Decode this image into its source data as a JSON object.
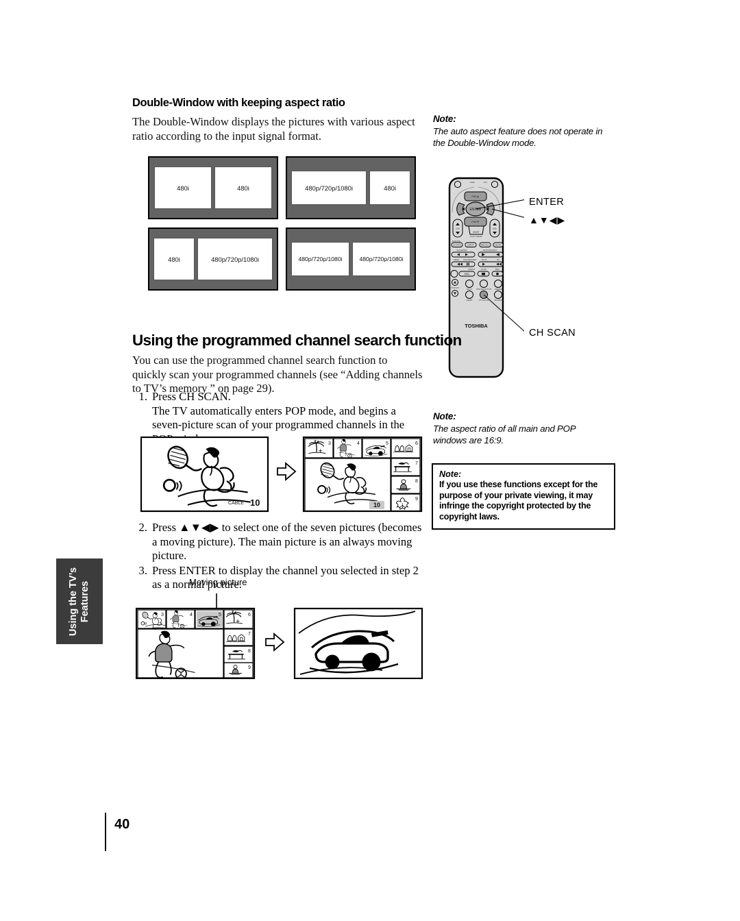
{
  "page": {
    "number": "40",
    "side_tab_label": "Using the TV’s\nFeatures"
  },
  "sections": {
    "double_window": {
      "heading": "Double-Window with keeping aspect ratio",
      "body": "The Double-Window displays the pictures with various aspect ratio according to the input signal format."
    },
    "channel_search": {
      "heading": "Using the programmed channel search function",
      "body": "You can use the programmed channel search function to quickly scan your programmed channels (see “Adding channels to TV’s memory ” on page 29).",
      "steps": [
        {
          "num": "1.",
          "text": "Press CH SCAN.\nThe TV automatically enters POP mode, and begins a seven-picture scan of your programmed channels in the POP window."
        },
        {
          "num": "2.",
          "text": "Press ▲▼◀▶ to select one of the seven pictures (becomes a moving picture). The main picture is an always moving picture."
        },
        {
          "num": "3.",
          "text": "Press ENTER to display the channel you selected in step 2 as a normal picture."
        }
      ]
    }
  },
  "notes": {
    "auto_aspect": {
      "title": "Note:",
      "text": "The auto aspect feature does not operate in the Double-Window mode."
    },
    "aspect_169": {
      "title": "Note:",
      "text": "The aspect ratio of all main and POP windows are 16:9."
    },
    "copyright": {
      "title": "Note:",
      "text": "If you use these functions except for the purpose of your private viewing, it may infringe the copyright protected by the copyright laws."
    }
  },
  "double_window_diagrams": [
    {
      "id": "dw-1",
      "left_pane": "480i",
      "right_pane": "480i",
      "left_shape": "square",
      "right_shape": "square"
    },
    {
      "id": "dw-2",
      "left_pane": "480p/720p/1080i",
      "right_pane": "480i",
      "left_shape": "wide",
      "right_shape": "narrow"
    },
    {
      "id": "dw-3",
      "left_pane": "480i",
      "right_pane": "480p/720p/1080i",
      "left_shape": "square-small",
      "right_shape": "wide-tall"
    },
    {
      "id": "dw-4",
      "left_pane": "480p/720p/1080i",
      "right_pane": "480p/720p/1080i",
      "left_shape": "half",
      "right_shape": "half"
    }
  ],
  "remote": {
    "brand": "TOSHIBA",
    "center_button": "ENTER",
    "fav_up": "FAV▲",
    "fav_down": "FAV▼",
    "exit_button": "EXIT",
    "exit_sub": "DVD CLEAR",
    "ch_rocker": "CH",
    "vol_rocker": "VOL",
    "row_labels_1": [
      "CH RTN",
      "INPUT",
      "RECALL",
      "MUTE"
    ],
    "row_labels_1_top": [
      "DVD RTN",
      "",
      "",
      ""
    ],
    "transport_group_1": "SLOW/DIR",
    "transport_group_2": "SKIP/SEARCH",
    "transport_labels_2": [
      "REW",
      "PAUSE/STEP",
      "PLAY",
      "FF"
    ],
    "transport_labels_3": [
      "AM/FM",
      "STOP",
      "REC"
    ],
    "disc_button": "DISC",
    "bottom_labels": [
      "POP CH",
      "SPLIT",
      "POP/DIR/CTCH",
      "FREEZE",
      "SWAP",
      "CH SCAN",
      "SOURCE"
    ],
    "callouts": [
      {
        "name": "enter",
        "label": "ENTER"
      },
      {
        "name": "arrows",
        "label": "▲▼◀▶"
      },
      {
        "name": "ch-scan",
        "label": "CH SCAN"
      }
    ]
  },
  "pop_illustrations": {
    "moving_picture_label": "Moving picture",
    "first": {
      "left_screen": {
        "scene": "tennis-player",
        "channel_band": "CABLE",
        "channel_number": "10"
      },
      "right_screen": {
        "main_scene": "tennis-player",
        "main_channel": "10",
        "thumbnails_top": [
          {
            "num": "3",
            "scene": "palm-beach"
          },
          {
            "num": "4",
            "scene": "soccer-player"
          },
          {
            "num": "5",
            "scene": "race-car"
          },
          {
            "num": "6",
            "scene": "house-trees"
          }
        ],
        "thumbnails_right": [
          {
            "num": "7",
            "scene": "table-lamp"
          },
          {
            "num": "8",
            "scene": "news-anchor"
          },
          {
            "num": "9",
            "scene": "flower"
          }
        ]
      }
    },
    "second": {
      "left_screen": {
        "main_scene": "soccer-player",
        "thumbnails_top": [
          {
            "num": "3",
            "scene": "tennis-player"
          },
          {
            "num": "4",
            "scene": "soccer-player"
          },
          {
            "num": "5",
            "scene": "race-car",
            "highlighted": true
          },
          {
            "num": "6",
            "scene": "palm-beach"
          }
        ],
        "thumbnails_right": [
          {
            "num": "7",
            "scene": "house-trees"
          },
          {
            "num": "8",
            "scene": "table-lamp"
          },
          {
            "num": "9",
            "scene": "news-anchor"
          }
        ]
      },
      "right_screen": {
        "scene": "race-car"
      }
    }
  },
  "colors": {
    "diagram_frame": "#636363",
    "tab_background": "#3c3c3c",
    "remote_body": "#d9d9d9",
    "remote_key": "#9a9a9a"
  }
}
